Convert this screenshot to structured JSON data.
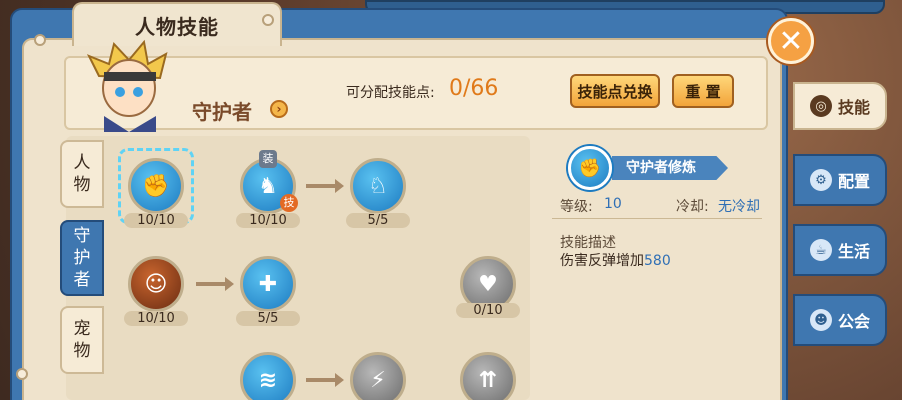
{
  "window": {
    "title": "人物技能"
  },
  "header": {
    "role_name": "守护者",
    "points_label": "可分配技能点:",
    "points_value": "0/66",
    "exchange_label": "技能点兑换",
    "reset_label": "重 置"
  },
  "side_tabs_left": [
    {
      "label_l1": "人",
      "label_l2": "物"
    },
    {
      "label_l1": "守",
      "label_l2": "护",
      "label_l3": "者"
    },
    {
      "label_l1": "宠",
      "label_l2": "物"
    }
  ],
  "side_tabs_right": [
    {
      "label": "技能",
      "icon": "compass-icon"
    },
    {
      "label": "配置",
      "icon": "gear-icon"
    },
    {
      "label": "生活",
      "icon": "cup-icon"
    },
    {
      "label": "公会",
      "icon": "people-icon"
    }
  ],
  "skills": [
    {
      "level": "10/10",
      "style": "blue"
    },
    {
      "level": "10/10",
      "style": "blue",
      "equip_badge": "装",
      "skill_badge": "技"
    },
    {
      "level": "5/5",
      "style": "blue"
    },
    {
      "level": "10/10",
      "style": "bronze"
    },
    {
      "level": "5/5",
      "style": "blue"
    },
    {
      "level": "0/10",
      "style": "grey"
    }
  ],
  "detail": {
    "name": "守护者修炼",
    "level_label": "等级:",
    "level_value": "10",
    "cooldown_label": "冷却:",
    "cooldown_value": "无冷却",
    "desc_title": "技能描述",
    "desc_text": "伤害反弹增加",
    "desc_value": "580"
  },
  "colors": {
    "accent_blue": "#3f77b0",
    "orange": "#e07a1a",
    "panel": "#efe3cc"
  }
}
